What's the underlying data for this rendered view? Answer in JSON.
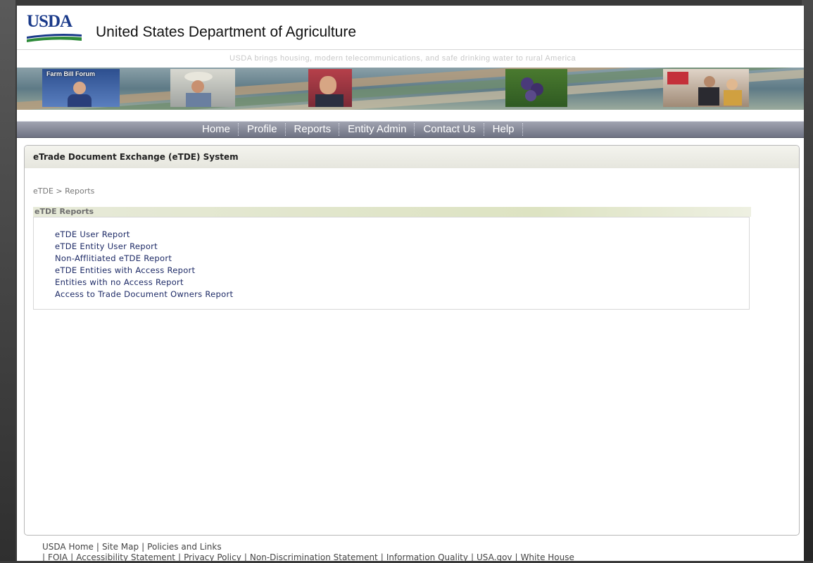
{
  "header": {
    "logo_text": "USDA",
    "department": "United States Department of Agriculture",
    "tagline": "USDA brings housing, modern telecommunications, and safe drinking water to rural America",
    "banner_label": "Farm Bill Forum"
  },
  "nav": {
    "items": [
      "Home",
      "Profile",
      "Reports",
      "Entity Admin",
      "Contact Us",
      "Help"
    ]
  },
  "content": {
    "title": "eTrade Document Exchange (eTDE) System",
    "breadcrumb": {
      "root": "eTDE",
      "separator": ">",
      "current": "Reports"
    },
    "section_title": "eTDE Reports",
    "reports": [
      "eTDE User Report",
      "eTDE Entity User Report",
      "Non-Afflitiated eTDE Report",
      "eTDE Entities with Access Report",
      "Entities with no Access Report",
      "Access to Trade Document Owners Report"
    ]
  },
  "footer": {
    "row1": [
      "USDA Home",
      "Site Map",
      "Policies and Links"
    ],
    "row2": [
      "FOIA",
      "Accessibility Statement",
      "Privacy Policy",
      "Non-Discrimination Statement",
      "Information Quality",
      "USA.gov",
      "White House"
    ]
  },
  "colors": {
    "nav_bg": "#7d8090",
    "title_bar": "#ecece4",
    "link": "#1d2a66",
    "usda_blue": "#1a3a8a",
    "usda_green": "#2e8b3a"
  }
}
